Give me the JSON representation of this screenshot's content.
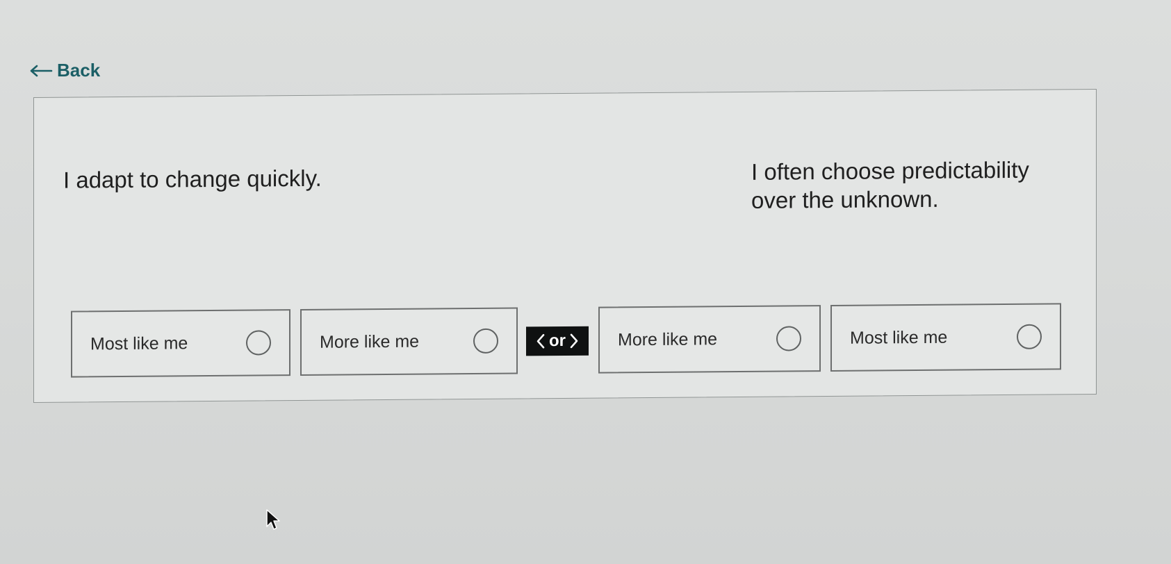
{
  "navigation": {
    "back_label": "Back"
  },
  "question": {
    "left_statement": "I adapt to change quickly.",
    "right_statement": "I often choose predictability over the unknown.",
    "divider_label": "or",
    "options": [
      {
        "label": "Most like me",
        "selected": false
      },
      {
        "label": "More like me",
        "selected": false
      },
      {
        "label": "More like me",
        "selected": false
      },
      {
        "label": "Most like me",
        "selected": false
      }
    ]
  },
  "icons": {
    "back": "arrow-left-icon",
    "divider_left": "chevron-left-icon",
    "divider_right": "chevron-right-icon",
    "radio": "radio-unselected-icon",
    "cursor": "mouse-pointer-icon"
  },
  "colors": {
    "link": "#1b5f66",
    "divider_bg": "#0f1111",
    "border": "#6d6f6f"
  }
}
